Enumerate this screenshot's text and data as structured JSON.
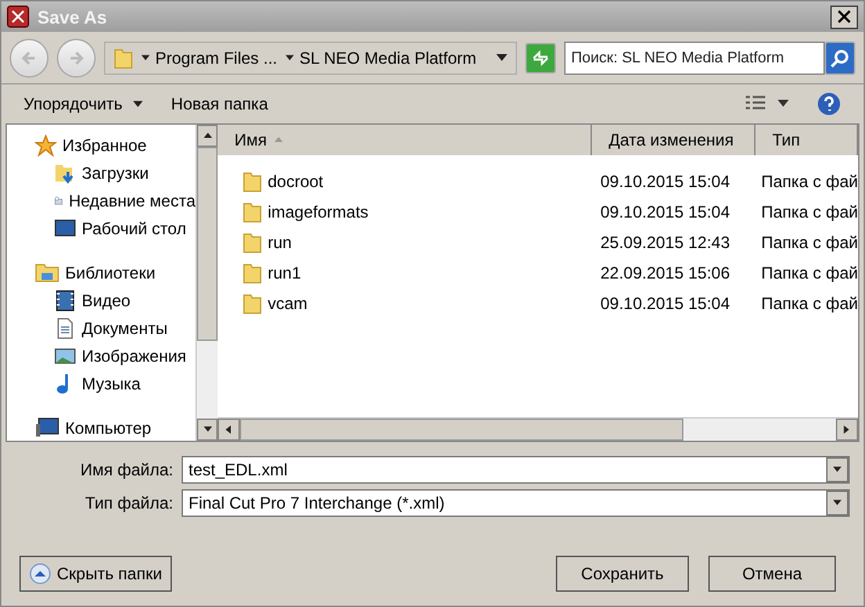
{
  "window": {
    "title": "Save As"
  },
  "address": {
    "crumbs": [
      "Program Files ...",
      "SL NEO Media Platform"
    ]
  },
  "search": {
    "placeholder": "Поиск: SL NEO Media Platform"
  },
  "toolbar": {
    "organize": "Упорядочить",
    "new_folder": "Новая папка"
  },
  "sidebar": {
    "groups": [
      {
        "label": "Избранное",
        "kind": "favorites",
        "children": [
          {
            "label": "Загрузки",
            "kind": "downloads"
          },
          {
            "label": "Недавние места",
            "kind": "recent"
          },
          {
            "label": "Рабочий стол",
            "kind": "desktop"
          }
        ]
      },
      {
        "label": "Библиотеки",
        "kind": "libraries",
        "children": [
          {
            "label": "Видео",
            "kind": "video"
          },
          {
            "label": "Документы",
            "kind": "documents"
          },
          {
            "label": "Изображения",
            "kind": "pictures"
          },
          {
            "label": "Музыка",
            "kind": "music"
          }
        ]
      },
      {
        "label": "Компьютер",
        "kind": "computer"
      }
    ]
  },
  "table": {
    "columns": [
      "Имя",
      "Дата изменения",
      "Тип"
    ],
    "rows": [
      {
        "name": "docroot",
        "date": "09.10.2015 15:04",
        "type": "Папка с фай"
      },
      {
        "name": "imageformats",
        "date": "09.10.2015 15:04",
        "type": "Папка с фай"
      },
      {
        "name": "run",
        "date": "25.09.2015 12:43",
        "type": "Папка с фай"
      },
      {
        "name": "run1",
        "date": "22.09.2015 15:06",
        "type": "Папка с фай"
      },
      {
        "name": "vcam",
        "date": "09.10.2015 15:04",
        "type": "Папка с фай"
      }
    ]
  },
  "fields": [
    {
      "label": "Имя файла:",
      "value": "test_EDL.xml"
    },
    {
      "label": "Тип файла:",
      "value": "Final Cut Pro 7 Interchange (*.xml)"
    }
  ],
  "hide_folders": "Скрыть папки",
  "buttons": [
    "Сохранить",
    "Отмена"
  ]
}
